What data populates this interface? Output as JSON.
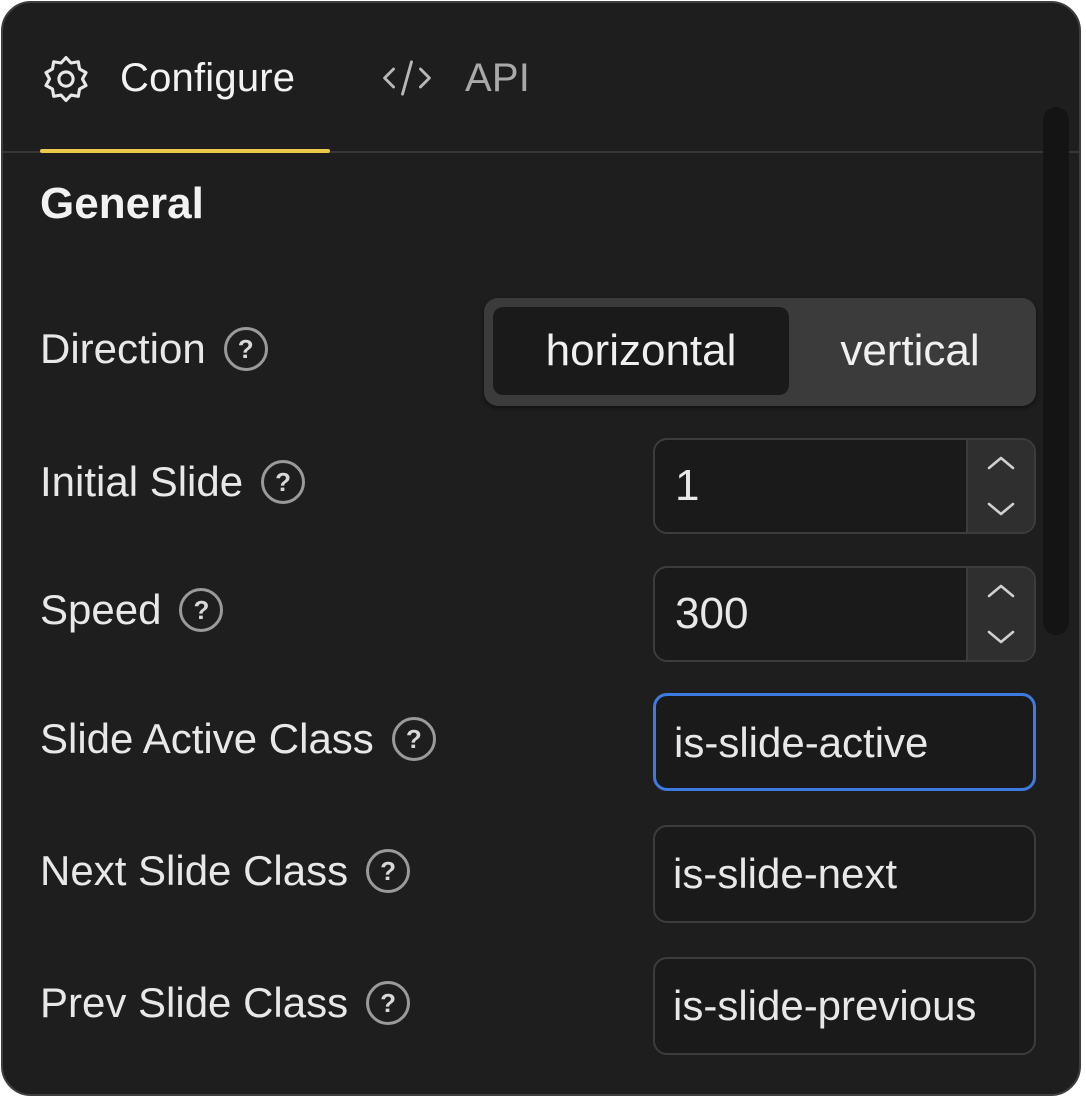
{
  "tabs": {
    "configure_label": "Configure",
    "configure_icon": "gear-icon",
    "api_label": "API",
    "api_icon": "code-icon",
    "active": "Configure",
    "active_underline_color": "#ecc94b"
  },
  "section": {
    "title": "General"
  },
  "fields": {
    "direction": {
      "label": "Direction",
      "options": [
        "horizontal",
        "vertical"
      ],
      "selected": "horizontal"
    },
    "initial_slide": {
      "label": "Initial Slide",
      "value": "1"
    },
    "speed": {
      "label": "Speed",
      "value": "300"
    },
    "slide_active_class": {
      "label": "Slide Active Class",
      "value": "is-slide-active"
    },
    "next_slide_class": {
      "label": "Next Slide Class",
      "value": "is-slide-next"
    },
    "prev_slide_class": {
      "label": "Prev Slide Class",
      "value": "is-slide-previous"
    }
  },
  "help_glyph": "?",
  "colors": {
    "panel_background": "#1e1e1e",
    "focus_ring": "#3d7be0"
  }
}
